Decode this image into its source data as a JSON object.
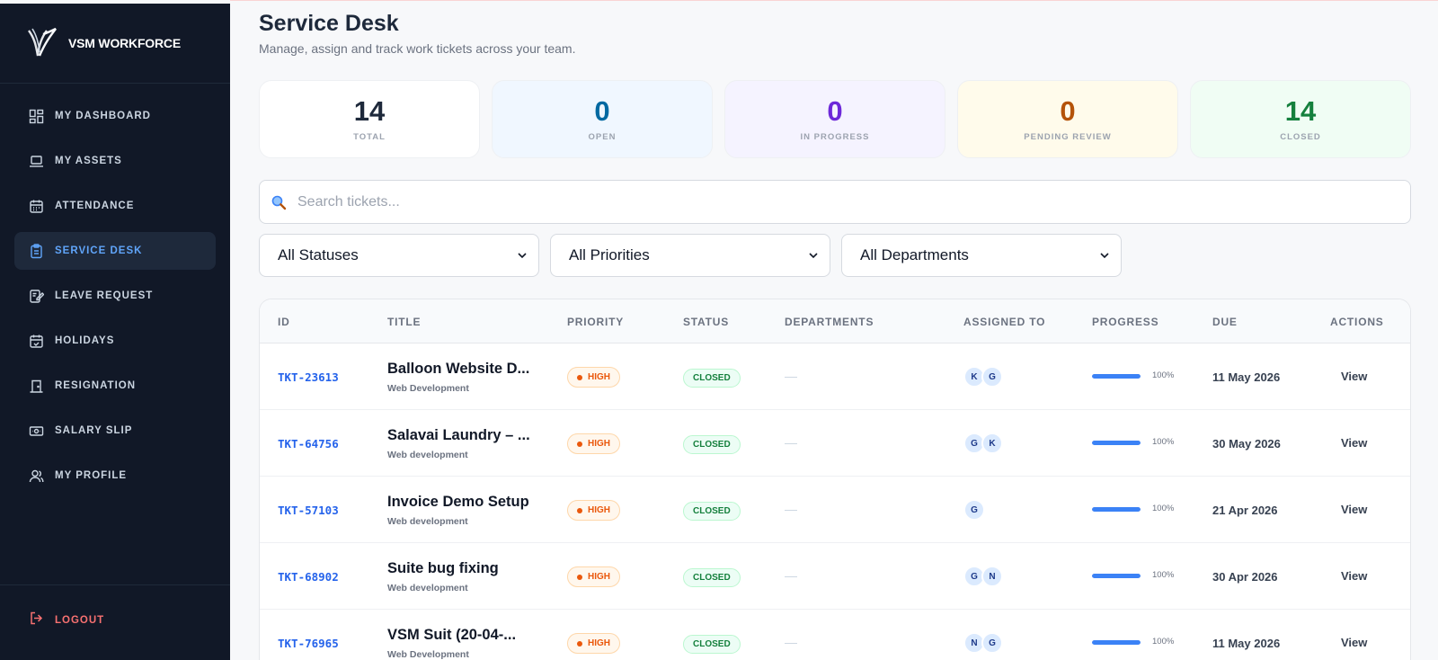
{
  "app": {
    "name": "VSM WORKFORCE"
  },
  "sidebar": {
    "items": [
      {
        "label": "MY DASHBOARD",
        "icon": "dashboard-icon",
        "active": false
      },
      {
        "label": "MY ASSETS",
        "icon": "laptop-icon",
        "active": false
      },
      {
        "label": "ATTENDANCE",
        "icon": "calendar-icon",
        "active": false
      },
      {
        "label": "SERVICE DESK",
        "icon": "clipboard-icon",
        "active": true
      },
      {
        "label": "LEAVE REQUEST",
        "icon": "edit-note-icon",
        "active": false
      },
      {
        "label": "HOLIDAYS",
        "icon": "calendar-check-icon",
        "active": false
      },
      {
        "label": "RESIGNATION",
        "icon": "door-icon",
        "active": false
      },
      {
        "label": "SALARY SLIP",
        "icon": "money-icon",
        "active": false
      },
      {
        "label": "MY PROFILE",
        "icon": "users-icon",
        "active": false
      }
    ],
    "logout_label": "LOGOUT"
  },
  "header": {
    "title": "Service Desk",
    "subtitle": "Manage, assign and track work tickets across your team."
  },
  "stats": [
    {
      "value": "14",
      "label": "TOTAL",
      "color": "#1e293b",
      "bg": "#ffffff"
    },
    {
      "value": "0",
      "label": "OPEN",
      "color": "#0369a1",
      "bg": "#f0f7ff"
    },
    {
      "value": "0",
      "label": "IN PROGRESS",
      "color": "#6d28d9",
      "bg": "#f5f3ff"
    },
    {
      "value": "0",
      "label": "PENDING REVIEW",
      "color": "#b45309",
      "bg": "#fffbeb"
    },
    {
      "value": "14",
      "label": "CLOSED",
      "color": "#15803d",
      "bg": "#f0fdf4"
    }
  ],
  "search": {
    "placeholder": "Search tickets..."
  },
  "filters": {
    "status": "All Statuses",
    "priority": "All Priorities",
    "department": "All Departments"
  },
  "table": {
    "columns": [
      "ID",
      "TITLE",
      "PRIORITY",
      "STATUS",
      "DEPARTMENTS",
      "ASSIGNED TO",
      "PROGRESS",
      "DUE",
      "ACTIONS"
    ],
    "rows": [
      {
        "id": "TKT-23613",
        "title": "Balloon Website D...",
        "dept": "Web Development",
        "priority": "HIGH",
        "status": "CLOSED",
        "departments": "—",
        "assignees": [
          "K",
          "G"
        ],
        "progress": 100,
        "progress_label": "100%",
        "due": "11 May 2026",
        "action": "View"
      },
      {
        "id": "TKT-64756",
        "title": "Salavai Laundry – ...",
        "dept": "Web development",
        "priority": "HIGH",
        "status": "CLOSED",
        "departments": "—",
        "assignees": [
          "G",
          "K"
        ],
        "progress": 100,
        "progress_label": "100%",
        "due": "30 May 2026",
        "action": "View"
      },
      {
        "id": "TKT-57103",
        "title": "Invoice Demo Setup",
        "dept": "Web development",
        "priority": "HIGH",
        "status": "CLOSED",
        "departments": "—",
        "assignees": [
          "G"
        ],
        "progress": 100,
        "progress_label": "100%",
        "due": "21 Apr 2026",
        "action": "View"
      },
      {
        "id": "TKT-68902",
        "title": "Suite bug fixing",
        "dept": "Web development",
        "priority": "HIGH",
        "status": "CLOSED",
        "departments": "—",
        "assignees": [
          "G",
          "N"
        ],
        "progress": 100,
        "progress_label": "100%",
        "due": "30 Apr 2026",
        "action": "View"
      },
      {
        "id": "TKT-76965",
        "title": "VSM Suit (20-04-...",
        "dept": "Web Development",
        "priority": "HIGH",
        "status": "CLOSED",
        "departments": "—",
        "assignees": [
          "N",
          "G"
        ],
        "progress": 100,
        "progress_label": "100%",
        "due": "11 May 2026",
        "action": "View"
      }
    ]
  }
}
